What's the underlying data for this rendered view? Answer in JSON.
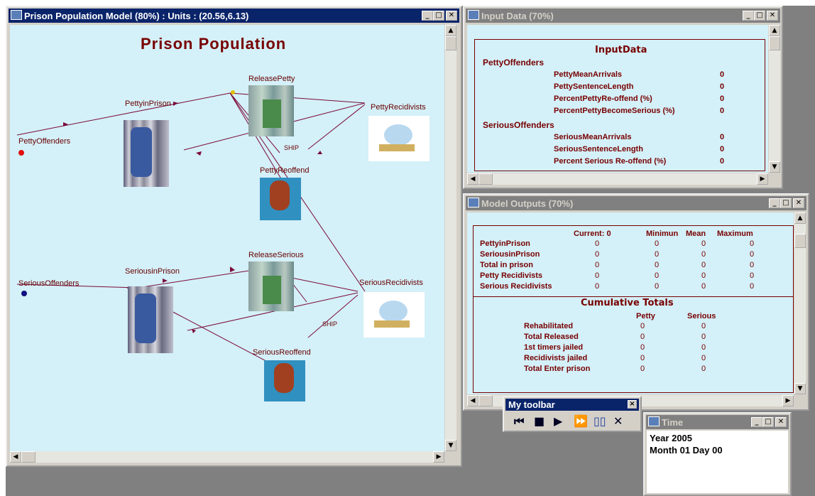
{
  "model": {
    "title": "Prison Population Model (80%) : Units : (20.56,6.13)",
    "heading": "Prison Population",
    "labels": {
      "petty_offenders": "PettyOffenders",
      "petty_in_prison": "PettyinPrison",
      "release_petty": "ReleasePetty",
      "petty_recidivists": "PettyRecidivists",
      "petty_reoffend": "PettyReoffend",
      "serious_offenders": "SeriousOffenders",
      "serious_in_prison": "SeriousinPrison",
      "release_serious": "ReleaseSerious",
      "serious_recidivists": "SeriousRecidivists",
      "serious_reoffend": "SeriousReoffend",
      "ship1": "SHIP",
      "ship2": "SHIP"
    }
  },
  "input": {
    "title": "Input Data (70%)",
    "heading": "InputData",
    "petty_header": "PettyOffenders",
    "petty_rows": [
      {
        "label": "PettyMeanArrivals",
        "value": "0"
      },
      {
        "label": "PettySentenceLength",
        "value": "0"
      },
      {
        "label": "PercentPettyRe-offend (%)",
        "value": "0"
      },
      {
        "label": "PercentPettyBecomeSerious (%)",
        "value": "0"
      }
    ],
    "serious_header": "SeriousOffenders",
    "serious_rows": [
      {
        "label": "SeriousMeanArrivals",
        "value": "0"
      },
      {
        "label": "SeriousSentenceLength",
        "value": "0"
      },
      {
        "label": "Percent Serious Re-offend (%)",
        "value": "0"
      }
    ]
  },
  "outputs": {
    "title": "Model Outputs (70%)",
    "cols": [
      "Current: 0",
      "Minimun",
      "Mean",
      "Maximum"
    ],
    "rows": [
      {
        "label": "PettyinPrison",
        "v": [
          "0",
          "0",
          "0",
          "0"
        ]
      },
      {
        "label": "SeriousinPrison",
        "v": [
          "0",
          "0",
          "0",
          "0"
        ]
      },
      {
        "label": "Total in prison",
        "v": [
          "0",
          "0",
          "0",
          "0"
        ]
      },
      {
        "label": "Petty Recidivists",
        "v": [
          "0",
          "0",
          "0",
          "0"
        ]
      },
      {
        "label": "Serious Recidivists",
        "v": [
          "0",
          "0",
          "0",
          "0"
        ]
      }
    ],
    "cum_heading": "Cumulative Totals",
    "cum_cols": [
      "Petty",
      "Serious"
    ],
    "cum_rows": [
      {
        "label": "Rehabilitated",
        "v": [
          "0",
          "0"
        ]
      },
      {
        "label": "Total Released",
        "v": [
          "0",
          "0"
        ]
      },
      {
        "label": "1st timers jailed",
        "v": [
          "0",
          "0"
        ]
      },
      {
        "label": "Recidivists jailed",
        "v": [
          "0",
          "0"
        ]
      },
      {
        "label": "Total Enter prison",
        "v": [
          "0",
          "0"
        ]
      }
    ]
  },
  "toolbar": {
    "title": "My toolbar",
    "close": "×",
    "buttons": [
      {
        "name": "rewind-icon",
        "glyph": "⏮"
      },
      {
        "name": "stop-icon",
        "glyph": "■"
      },
      {
        "name": "play-icon",
        "glyph": "▶"
      },
      {
        "name": "fast-forward-icon",
        "glyph": "⏩"
      },
      {
        "name": "book-icon",
        "glyph": "▯▯"
      },
      {
        "name": "close-x-icon",
        "glyph": "✕"
      }
    ]
  },
  "time": {
    "title": "Time",
    "year": "Year 2005",
    "month": "Month 01 Day 00"
  },
  "colors": {
    "canvas": "#d4f0f8",
    "label": "#660000",
    "active_title": "#0a246a"
  }
}
